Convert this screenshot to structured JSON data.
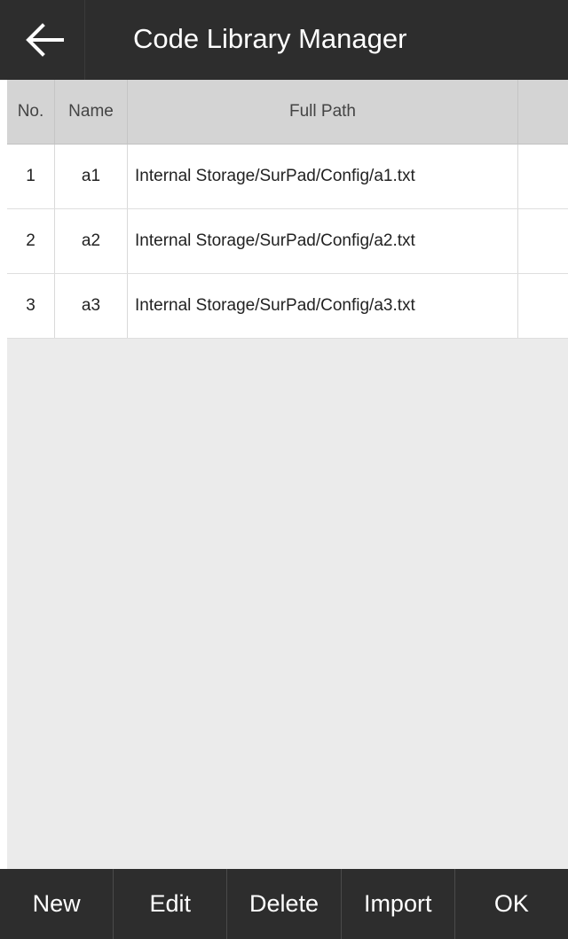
{
  "header": {
    "title": "Code Library Manager",
    "back_icon": "arrow-left-icon"
  },
  "table": {
    "columns": [
      "No.",
      "Name",
      "Full Path",
      ""
    ],
    "rows": [
      {
        "no": "1",
        "name": "a1",
        "path": "Internal Storage/SurPad/Config/a1.txt"
      },
      {
        "no": "2",
        "name": "a2",
        "path": "Internal Storage/SurPad/Config/a2.txt"
      },
      {
        "no": "3",
        "name": "a3",
        "path": "Internal Storage/SurPad/Config/a3.txt"
      }
    ]
  },
  "footer": {
    "buttons": [
      "New",
      "Edit",
      "Delete",
      "Import",
      "OK"
    ]
  },
  "colors": {
    "bar_bg": "#2d2d2d",
    "content_bg": "#ebebeb",
    "header_row_bg": "#d4d4d4"
  }
}
